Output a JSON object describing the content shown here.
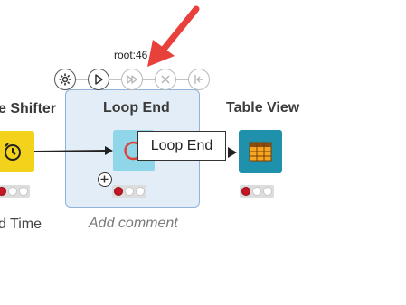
{
  "nodes": {
    "shifter": {
      "title": "e Shifter",
      "subtitle": "d Time",
      "color": "#f3d21b"
    },
    "loop_end": {
      "title": "Loop End",
      "workflow_id": "root:46",
      "comment_placeholder": "Add comment",
      "tooltip": "Loop End",
      "color": "#8fd7e8"
    },
    "table_view": {
      "title": "Table View",
      "color": "#1f91ad"
    }
  },
  "toolbar": {
    "buttons": [
      {
        "name": "configure-button",
        "icon": "gear-icon",
        "enabled": true
      },
      {
        "name": "execute-button",
        "icon": "play-icon",
        "enabled": true
      },
      {
        "name": "step-loop-button",
        "icon": "step-loop-icon",
        "enabled": false
      },
      {
        "name": "cancel-button",
        "icon": "close-icon",
        "enabled": false
      },
      {
        "name": "reset-button",
        "icon": "reset-icon",
        "enabled": false
      }
    ]
  },
  "status": {
    "traffic_light_states": [
      "red",
      "off",
      "off"
    ]
  },
  "annotation": {
    "arrow_color": "#e8403a"
  }
}
